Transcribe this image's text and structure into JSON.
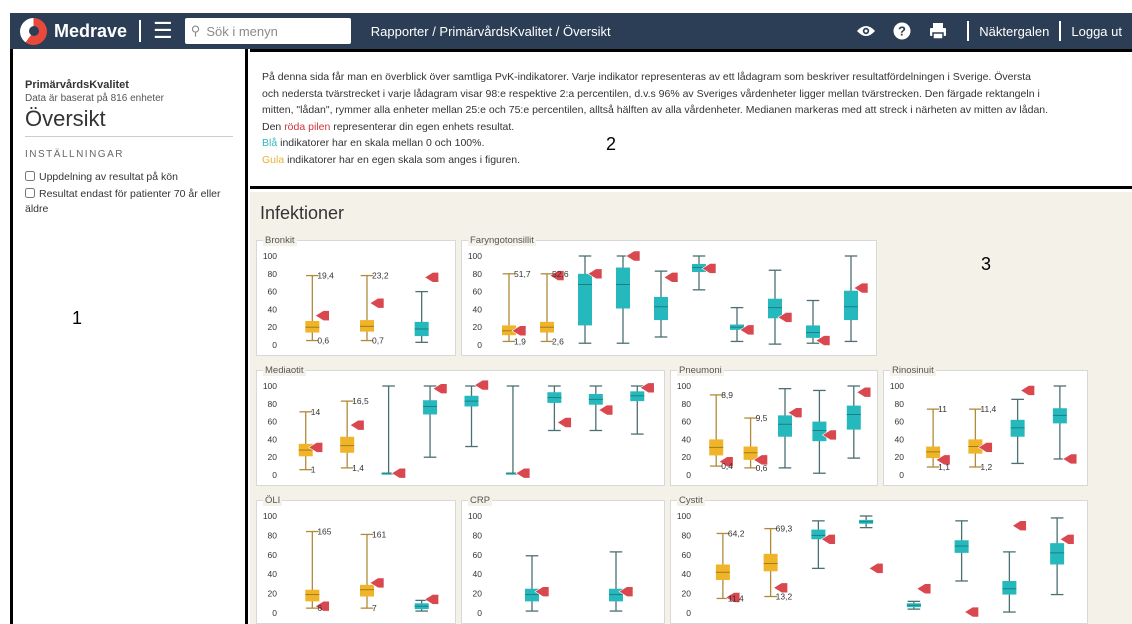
{
  "app": {
    "brand": "Medrave",
    "search_placeholder": "Sök i menyn",
    "breadcrumb": "Rapporter / PrimärvårdsKvalitet / Översikt",
    "user": "Näktergalen",
    "logout": "Logga ut"
  },
  "sidebar": {
    "title": "PrimärvårdsKvalitet",
    "subtitle": "Data är baserat på 816 enheter",
    "heading": "Översikt",
    "settings_label": "INSTÄLLNINGAR",
    "options": [
      "Uppdelning av resultat på kön",
      "Resultat endast för patienter 70 år eller äldre"
    ]
  },
  "annotations": [
    "1",
    "2",
    "3"
  ],
  "info": {
    "line1": "På denna sida får man en överblick över samtliga PvK-indikatorer. Varje indikator representeras av ett lådagram som beskriver resultatfördelningen i Sverige. Översta",
    "line2": "och nedersta tvärstrecket i varje lådagram visar 98:e respektive 2:a percentilen, d.v.s 96% av Sveriges vårdenheter ligger mellan tvärstrecken. Den färgade rektangeln i",
    "line3": "mitten, \"lådan\", rymmer alla enheter mellan 25:e och 75:e percentilen, alltså hälften av alla vårdenheter. Medianen markeras med att streck i närheten av mitten av lådan.",
    "line4_pre": "Den ",
    "line4_red": "röda pilen",
    "line4_post": " representerar din egen enhets resultat.",
    "line5_blue": "Blå",
    "line5_post": " indikatorer har en skala mellan 0 och 100%.",
    "line6_yel": "Gula",
    "line6_post": " indikatorer har en egen skala som anges i figuren."
  },
  "section_title": "Infektioner",
  "colors": {
    "yellow": "#f0b429",
    "yellow_line": "#b08a3a",
    "teal": "#25b9bd",
    "teal_line": "#4c6f72",
    "marker": "#d9474f",
    "nav": "#2c3e55"
  },
  "chart_data": [
    {
      "type": "box",
      "title": "Bronkit",
      "ylim": [
        0,
        100
      ],
      "yticks": [
        0,
        20,
        40,
        60,
        80,
        100
      ],
      "boxes": [
        {
          "color": "yellow",
          "min": 5,
          "q1": 14,
          "median": 20,
          "q3": 27,
          "max": 78,
          "marker": 33,
          "label_top": "19,4",
          "label_bottom": "0,6"
        },
        {
          "color": "yellow",
          "min": 5,
          "q1": 15,
          "median": 21,
          "q3": 28,
          "max": 78,
          "marker": 47,
          "label_top": "23,2",
          "label_bottom": "0,7"
        },
        {
          "color": "teal",
          "min": 3,
          "q1": 10,
          "median": 18,
          "q3": 26,
          "max": 60,
          "marker": 76
        }
      ]
    },
    {
      "type": "box",
      "title": "Faryngotonsillit",
      "ylim": [
        0,
        100
      ],
      "yticks": [
        0,
        20,
        40,
        60,
        80,
        100
      ],
      "boxes": [
        {
          "color": "yellow",
          "min": 4,
          "q1": 11,
          "median": 16,
          "q3": 22,
          "max": 80,
          "marker": 16,
          "label_top": "51,7",
          "label_bottom": "1,9"
        },
        {
          "color": "yellow",
          "min": 4,
          "q1": 14,
          "median": 20,
          "q3": 26,
          "max": 80,
          "marker": 78,
          "label_top": "52,6",
          "label_bottom": "2,6"
        },
        {
          "color": "teal",
          "min": 2,
          "q1": 22,
          "median": 68,
          "q3": 80,
          "max": 100,
          "marker": 80
        },
        {
          "color": "teal",
          "min": 2,
          "q1": 41,
          "median": 68,
          "q3": 87,
          "max": 100,
          "marker": 100
        },
        {
          "color": "teal",
          "min": 9,
          "q1": 28,
          "median": 43,
          "q3": 54,
          "max": 83,
          "marker": 76
        },
        {
          "color": "teal",
          "min": 62,
          "q1": 82,
          "median": 87,
          "q3": 91,
          "max": 100,
          "marker": 86
        },
        {
          "color": "teal",
          "min": 4,
          "q1": 17,
          "median": 20,
          "q3": 23,
          "max": 42,
          "marker": 17
        },
        {
          "color": "teal",
          "min": 1,
          "q1": 30,
          "median": 42,
          "q3": 52,
          "max": 84,
          "marker": 31
        },
        {
          "color": "teal",
          "min": 2,
          "q1": 8,
          "median": 14,
          "q3": 22,
          "max": 50,
          "marker": 5
        },
        {
          "color": "teal",
          "min": 4,
          "q1": 28,
          "median": 43,
          "q3": 61,
          "max": 100,
          "marker": 64
        }
      ]
    },
    {
      "type": "box",
      "title": "Mediaotit",
      "ylim": [
        0,
        100
      ],
      "yticks": [
        0,
        20,
        40,
        60,
        80,
        100
      ],
      "boxes": [
        {
          "color": "yellow",
          "min": 6,
          "q1": 21,
          "median": 28,
          "q3": 35,
          "max": 71,
          "marker": 31,
          "label_top": "14",
          "label_bottom": "1"
        },
        {
          "color": "yellow",
          "min": 8,
          "q1": 25,
          "median": 33,
          "q3": 43,
          "max": 83,
          "marker": 56,
          "label_top": "16,5",
          "label_bottom": "1,4"
        },
        {
          "color": "teal",
          "min": 2,
          "q1": 2,
          "median": 2,
          "q3": 2,
          "max": 100,
          "marker": 2
        },
        {
          "color": "teal",
          "min": 20,
          "q1": 68,
          "median": 77,
          "q3": 84,
          "max": 100,
          "marker": 97
        },
        {
          "color": "teal",
          "min": 32,
          "q1": 77,
          "median": 83,
          "q3": 89,
          "max": 100,
          "marker": 101
        },
        {
          "color": "teal",
          "min": 2,
          "q1": 2,
          "median": 2,
          "q3": 2,
          "max": 100,
          "marker": 2
        },
        {
          "color": "teal",
          "min": 50,
          "q1": 81,
          "median": 87,
          "q3": 93,
          "max": 100,
          "marker": 59
        },
        {
          "color": "teal",
          "min": 50,
          "q1": 79,
          "median": 85,
          "q3": 91,
          "max": 100,
          "marker": 73
        },
        {
          "color": "teal",
          "min": 46,
          "q1": 83,
          "median": 89,
          "q3": 94,
          "max": 100,
          "marker": 98
        }
      ]
    },
    {
      "type": "box",
      "title": "Pneumoni",
      "ylim": [
        0,
        100
      ],
      "yticks": [
        0,
        20,
        40,
        60,
        80,
        100
      ],
      "boxes": [
        {
          "color": "yellow",
          "min": 10,
          "q1": 22,
          "median": 31,
          "q3": 40,
          "max": 90,
          "marker": 15,
          "label_top": "8,9",
          "label_bottom": "0,4"
        },
        {
          "color": "yellow",
          "min": 8,
          "q1": 17,
          "median": 25,
          "q3": 32,
          "max": 64,
          "marker": 17,
          "label_top": "9,5",
          "label_bottom": "0,6"
        },
        {
          "color": "teal",
          "min": 8,
          "q1": 43,
          "median": 57,
          "q3": 67,
          "max": 97,
          "marker": 70
        },
        {
          "color": "teal",
          "min": 2,
          "q1": 38,
          "median": 50,
          "q3": 60,
          "max": 95,
          "marker": 45
        },
        {
          "color": "teal",
          "min": 19,
          "q1": 51,
          "median": 68,
          "q3": 78,
          "max": 100,
          "marker": 93
        }
      ]
    },
    {
      "type": "box",
      "title": "Rinosinuit",
      "ylim": [
        0,
        100
      ],
      "yticks": [
        0,
        20,
        40,
        60,
        80,
        100
      ],
      "boxes": [
        {
          "color": "yellow",
          "min": 9,
          "q1": 19,
          "median": 26,
          "q3": 32,
          "max": 74,
          "marker": 17,
          "label_top": "11",
          "label_bottom": "1,1"
        },
        {
          "color": "yellow",
          "min": 9,
          "q1": 24,
          "median": 32,
          "q3": 40,
          "max": 74,
          "marker": 31,
          "label_top": "11,4",
          "label_bottom": "1,2"
        },
        {
          "color": "teal",
          "min": 13,
          "q1": 43,
          "median": 53,
          "q3": 62,
          "max": 85,
          "marker": 95
        },
        {
          "color": "teal",
          "min": 18,
          "q1": 58,
          "median": 67,
          "q3": 75,
          "max": 100,
          "marker": 18
        }
      ]
    },
    {
      "type": "box",
      "title": "ÖLI",
      "ylim": [
        0,
        100
      ],
      "yticks": [
        0,
        20,
        40,
        60,
        80,
        100
      ],
      "boxes": [
        {
          "color": "yellow",
          "min": 5,
          "q1": 12,
          "median": 19,
          "q3": 24,
          "max": 84,
          "marker": 7,
          "label_top": "165",
          "label_bottom": "6"
        },
        {
          "color": "yellow",
          "min": 5,
          "q1": 17,
          "median": 24,
          "q3": 29,
          "max": 81,
          "marker": 31,
          "label_top": "161",
          "label_bottom": "7"
        },
        {
          "color": "teal",
          "min": 2,
          "q1": 4,
          "median": 7,
          "q3": 10,
          "max": 13,
          "marker": 14
        }
      ]
    },
    {
      "type": "box",
      "title": "CRP",
      "ylim": [
        0,
        100
      ],
      "yticks": [
        0,
        20,
        40,
        60,
        80,
        100
      ],
      "boxes": [
        {
          "color": "teal",
          "min": 2,
          "q1": 12,
          "median": 19,
          "q3": 25,
          "max": 59,
          "marker": 22
        },
        {
          "color": "teal",
          "min": 2,
          "q1": 12,
          "median": 19,
          "q3": 25,
          "max": 63,
          "marker": 22
        }
      ]
    },
    {
      "type": "box",
      "title": "Cystit",
      "ylim": [
        0,
        100
      ],
      "yticks": [
        0,
        20,
        40,
        60,
        80,
        100
      ],
      "boxes": [
        {
          "color": "yellow",
          "min": 15,
          "q1": 34,
          "median": 42,
          "q3": 50,
          "max": 82,
          "marker": 16,
          "label_top": "64,2",
          "label_bottom": "11,4"
        },
        {
          "color": "yellow",
          "min": 17,
          "q1": 43,
          "median": 51,
          "q3": 61,
          "max": 87,
          "marker": 26,
          "label_top": "69,3",
          "label_bottom": "13,2"
        },
        {
          "color": "teal",
          "min": 46,
          "q1": 76,
          "median": 80,
          "q3": 86,
          "max": 95,
          "marker": 76
        },
        {
          "color": "teal",
          "min": 88,
          "q1": 92,
          "median": 94,
          "q3": 96,
          "max": 100,
          "marker": 46
        },
        {
          "color": "teal",
          "min": 4,
          "q1": 6,
          "median": 8,
          "q3": 10,
          "max": 12,
          "marker": 25
        },
        {
          "color": "teal",
          "min": 33,
          "q1": 62,
          "median": 69,
          "q3": 75,
          "max": 95,
          "marker": 1
        },
        {
          "color": "teal",
          "min": 1,
          "q1": 19,
          "median": 25,
          "q3": 33,
          "max": 63,
          "marker": 90
        },
        {
          "color": "teal",
          "min": 19,
          "q1": 50,
          "median": 62,
          "q3": 72,
          "max": 98,
          "marker": 76
        }
      ]
    }
  ]
}
